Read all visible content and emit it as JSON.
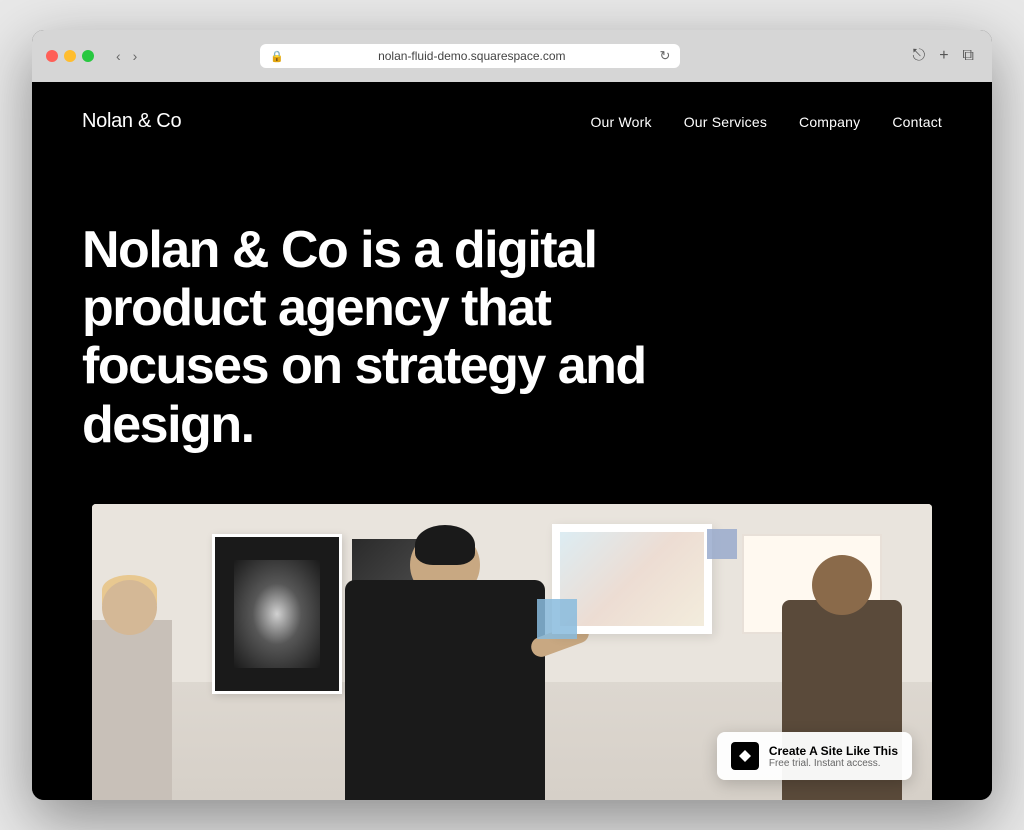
{
  "browser": {
    "url": "nolan-fluid-demo.squarespace.com",
    "nav_back": "‹",
    "nav_forward": "›",
    "window_control_colors": {
      "red": "#ff5f57",
      "yellow": "#ffbd2e",
      "green": "#28c840"
    }
  },
  "site": {
    "logo": "Nolan & Co",
    "nav": {
      "items": [
        "Our Work",
        "Our Services",
        "Company",
        "Contact"
      ]
    },
    "hero": {
      "headline": "Nolan & Co is a digital product agency that focuses on strategy and design."
    },
    "badge": {
      "title": "Create A Site Like This",
      "subtitle": "Free trial. Instant access."
    }
  }
}
